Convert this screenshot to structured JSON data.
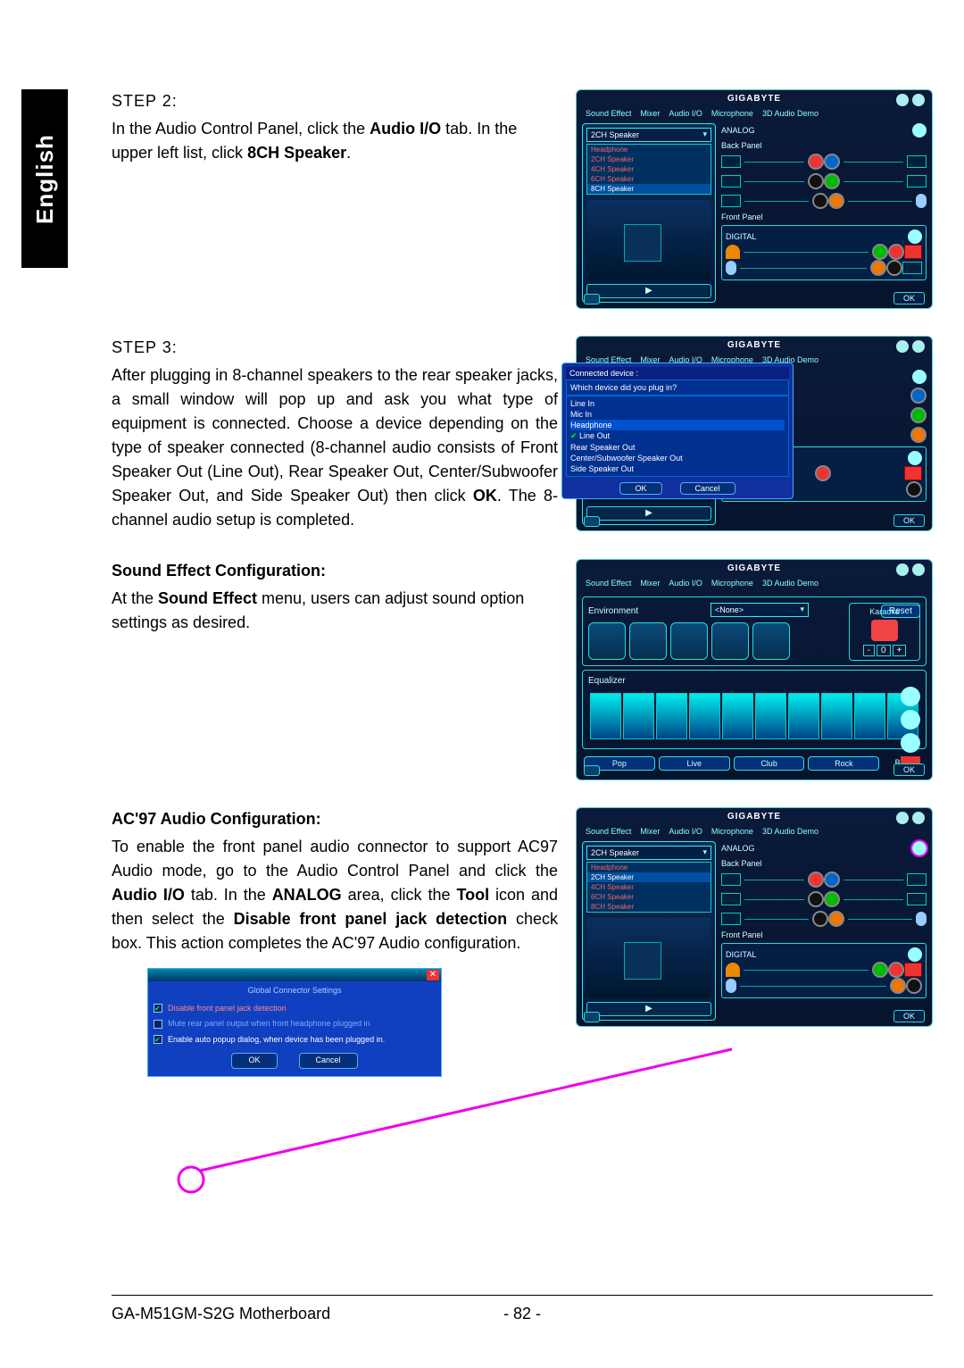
{
  "sideTab": "English",
  "panel": {
    "brand": "GIGABYTE",
    "tabs": [
      "Sound Effect",
      "Mixer",
      "Audio I/O",
      "Microphone",
      "3D Audio Demo"
    ],
    "speakerDropdown": "2CH Speaker",
    "speakerOptions": [
      "Headphone",
      "2CH Speaker",
      "4CH Speaker",
      "6CH Speaker",
      "8CH Speaker"
    ],
    "analogLabel": "ANALOG",
    "backPanelLabel": "Back Panel",
    "frontPanelLabel": "Front Panel",
    "digitalLabel": "DIGITAL",
    "okLabel": "OK"
  },
  "step2": {
    "title": "STEP 2:",
    "text_a": "In the Audio Control Panel, click the ",
    "text_b": "Audio I/O",
    "text_c": " tab. In the upper left list, click ",
    "text_d": "8CH Speaker",
    "text_e": "."
  },
  "step3": {
    "title": "STEP 3:",
    "t1": "After plugging in 8-channel speakers to the rear speaker jacks, a small window will pop up and ask you what type of equipment is connected. Choose a device depending on the type of speaker connected (8-channel audio consists of Front Speaker Out (Line Out), Rear Speaker Out, Center/Subwoofer Speaker Out, and Side Speaker Out) then click ",
    "t1b": "OK",
    "t1c": ". The 8-channel audio setup is completed.",
    "popup": {
      "head": "Connected device :",
      "question": "Which device did you plug in?",
      "items": [
        "Line In",
        "Mic In",
        "Headphone",
        "Line Out",
        "Rear Speaker Out",
        "Center/Subwoofer Speaker Out",
        "Side Speaker Out"
      ],
      "ok": "OK",
      "cancel": "Cancel"
    }
  },
  "soundEffect": {
    "head": "Sound Effect Configuration:",
    "t1": "At the ",
    "t1b": "Sound Effect",
    "t1c": " menu, users can adjust sound option settings as desired.",
    "envLabel": "Environment",
    "envValue": "<None>",
    "resetLabel": "Reset",
    "karaokeLabel": "Karaoke",
    "eqLabel": "Equalizer",
    "eqPresets": [
      "Pop",
      "Live",
      "Club",
      "Rock"
    ],
    "eqMore": "Bass"
  },
  "ac97": {
    "head": "AC'97 Audio Configuration:",
    "t1": "To enable the front panel audio connector to support AC97 Audio mode, go to the Audio Control Panel and click the ",
    "t1b": "Audio I/O",
    "t1c": " tab. In the ",
    "t1d": "ANALOG",
    "t1e": " area, click the ",
    "t1f": "Tool",
    "t1g": " icon and then select the ",
    "t1h": "Disable front panel jack detection",
    "t1i": " check box. This action completes the AC'97 Audio configuration.",
    "dlg": {
      "title": "Global Connector Settings",
      "opt1": "Disable front panel jack detection",
      "opt2": "Mute rear panel output when front headphone plugged in",
      "opt3": "Enable auto popup dialog, when device has been plugged in.",
      "ok": "OK",
      "cancel": "Cancel"
    }
  },
  "footer": {
    "model": "GA-M51GM-S2G Motherboard",
    "page": "- 82 -"
  }
}
